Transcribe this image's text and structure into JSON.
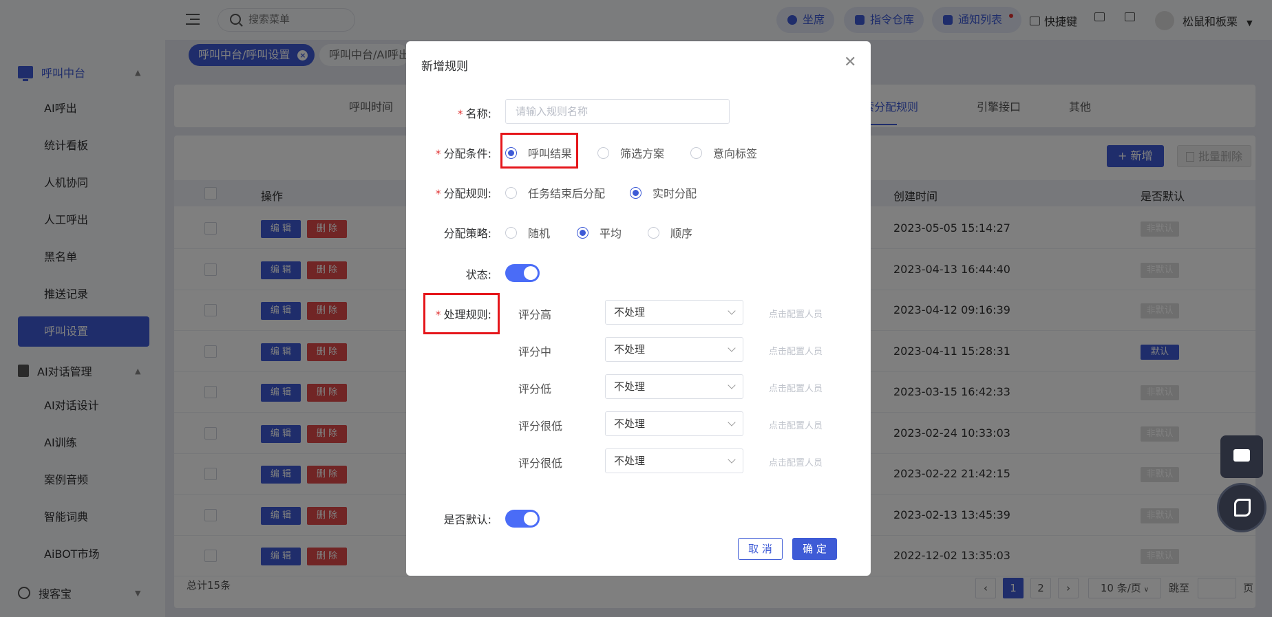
{
  "header": {
    "search_placeholder": "搜索菜单",
    "pills": [
      "坐席",
      "指令仓库",
      "通知列表"
    ],
    "shortcut_label": "快捷键",
    "username": "松鼠和板栗"
  },
  "sidebar": {
    "groups": [
      {
        "label": "呼叫中台",
        "items": [
          "AI呼出",
          "统计看板",
          "人机协同",
          "人工呼出",
          "黑名单",
          "推送记录",
          "呼叫设置"
        ]
      },
      {
        "label": "AI对话管理",
        "items": [
          "AI对话设计",
          "AI训练",
          "案例音频",
          "智能词典",
          "AiBOT市场"
        ]
      },
      {
        "label": "搜客宝",
        "items": []
      }
    ],
    "active_item": "呼叫设置"
  },
  "tags": {
    "active": "呼叫中台/呼叫设置",
    "other": "呼叫中台/AI呼出"
  },
  "tabs": {
    "first": "呼叫时间",
    "active": "线索分配规则",
    "engine": "引擎接口",
    "other": "其他"
  },
  "toolbar": {
    "add": "+ 新增",
    "bulk_delete": "批量删除"
  },
  "table": {
    "headers": {
      "action": "操作",
      "created": "创建时间",
      "default": "是否默认"
    },
    "edit_label": "编 辑",
    "delete_label": "删 除",
    "rows": [
      {
        "created": "2023-05-05 15:14:27",
        "default": "非默认",
        "is_default": false
      },
      {
        "created": "2023-04-13 16:44:40",
        "default": "非默认",
        "is_default": false
      },
      {
        "created": "2023-04-12 09:16:39",
        "default": "非默认",
        "is_default": false
      },
      {
        "created": "2023-04-11 15:28:31",
        "default": "默认",
        "is_default": true
      },
      {
        "created": "2023-03-15 16:42:33",
        "default": "非默认",
        "is_default": false
      },
      {
        "created": "2023-02-24 10:33:03",
        "default": "非默认",
        "is_default": false
      },
      {
        "created": "2023-02-22 21:42:15",
        "default": "非默认",
        "is_default": false
      },
      {
        "created": "2023-02-13 13:45:39",
        "default": "非默认",
        "is_default": false
      },
      {
        "created": "2022-12-02 13:35:03",
        "default": "非默认",
        "is_default": false
      }
    ],
    "total": "总计15条"
  },
  "pagination": {
    "pages": [
      "1",
      "2"
    ],
    "page_size": "10 条/页",
    "jump_label": "跳至",
    "page_suffix": "页"
  },
  "modal": {
    "title": "新增规则",
    "name_label": "名称:",
    "name_placeholder": "请输入规则名称",
    "condition_label": "分配条件:",
    "condition_options": [
      "呼叫结果",
      "筛选方案",
      "意向标签"
    ],
    "condition_selected": "呼叫结果",
    "rule_label": "分配规则:",
    "rule_options": [
      "任务结束后分配",
      "实时分配"
    ],
    "rule_selected": "实时分配",
    "strategy_label": "分配策略:",
    "strategy_options": [
      "随机",
      "平均",
      "顺序"
    ],
    "strategy_selected": "平均",
    "status_label": "状态:",
    "status_on": true,
    "process_label": "处理规则:",
    "process_rules": [
      {
        "label": "评分高",
        "value": "不处理",
        "link": "点击配置人员"
      },
      {
        "label": "评分中",
        "value": "不处理",
        "link": "点击配置人员"
      },
      {
        "label": "评分低",
        "value": "不处理",
        "link": "点击配置人员"
      },
      {
        "label": "评分很低",
        "value": "不处理",
        "link": "点击配置人员"
      },
      {
        "label": "评分很低",
        "value": "不处理",
        "link": "点击配置人员"
      }
    ],
    "default_label": "是否默认:",
    "default_on": true,
    "cancel": "取 消",
    "confirm": "确 定"
  },
  "colors": {
    "accent": "#3e5bd6",
    "danger": "#e24b4b",
    "highlight": "#e5161b"
  }
}
